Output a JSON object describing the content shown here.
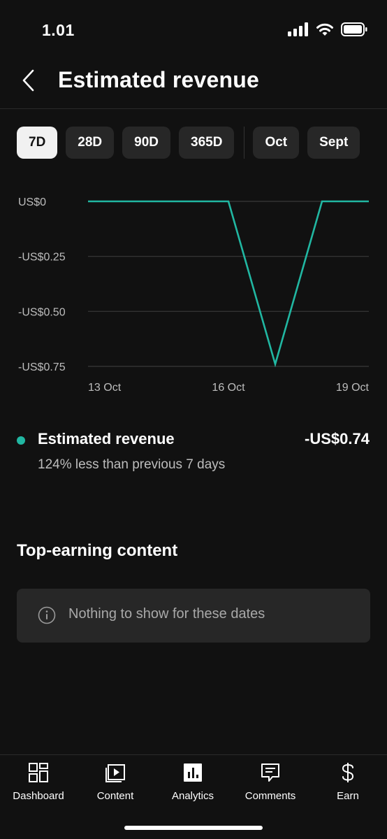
{
  "status_bar": {
    "time": "1.01"
  },
  "header": {
    "title": "Estimated revenue"
  },
  "date_chips": [
    {
      "label": "7D",
      "active": true
    },
    {
      "label": "28D",
      "active": false
    },
    {
      "label": "90D",
      "active": false
    },
    {
      "label": "365D",
      "active": false
    },
    {
      "label": "Oct",
      "active": false
    },
    {
      "label": "Sept",
      "active": false
    }
  ],
  "chart_data": {
    "type": "line",
    "x": [
      "13 Oct",
      "14 Oct",
      "15 Oct",
      "16 Oct",
      "17 Oct",
      "18 Oct",
      "19 Oct"
    ],
    "xticks": [
      "13 Oct",
      "16 Oct",
      "19 Oct"
    ],
    "yticks": [
      "US$0",
      "-US$0.25",
      "-US$0.50",
      "-US$0.75"
    ],
    "ytick_values": [
      0,
      -0.25,
      -0.5,
      -0.75
    ],
    "ylim": [
      -0.75,
      0
    ],
    "series": [
      {
        "values": [
          0,
          0,
          0,
          0,
          -0.74,
          0,
          0
        ],
        "color": "#21b7a2"
      }
    ],
    "grid": true
  },
  "metric": {
    "name": "Estimated revenue",
    "value": "-US$0.74",
    "comparison": "124% less than previous 7 days",
    "color": "#21b7a2"
  },
  "top_content": {
    "title": "Top-earning content",
    "empty_message": "Nothing to show for these dates",
    "icon": "info-icon"
  },
  "bottom_nav": [
    {
      "label": "Dashboard",
      "icon": "dashboard-icon"
    },
    {
      "label": "Content",
      "icon": "content-icon"
    },
    {
      "label": "Analytics",
      "icon": "analytics-icon",
      "active": true
    },
    {
      "label": "Comments",
      "icon": "comments-icon"
    },
    {
      "label": "Earn",
      "icon": "dollar-icon"
    }
  ]
}
